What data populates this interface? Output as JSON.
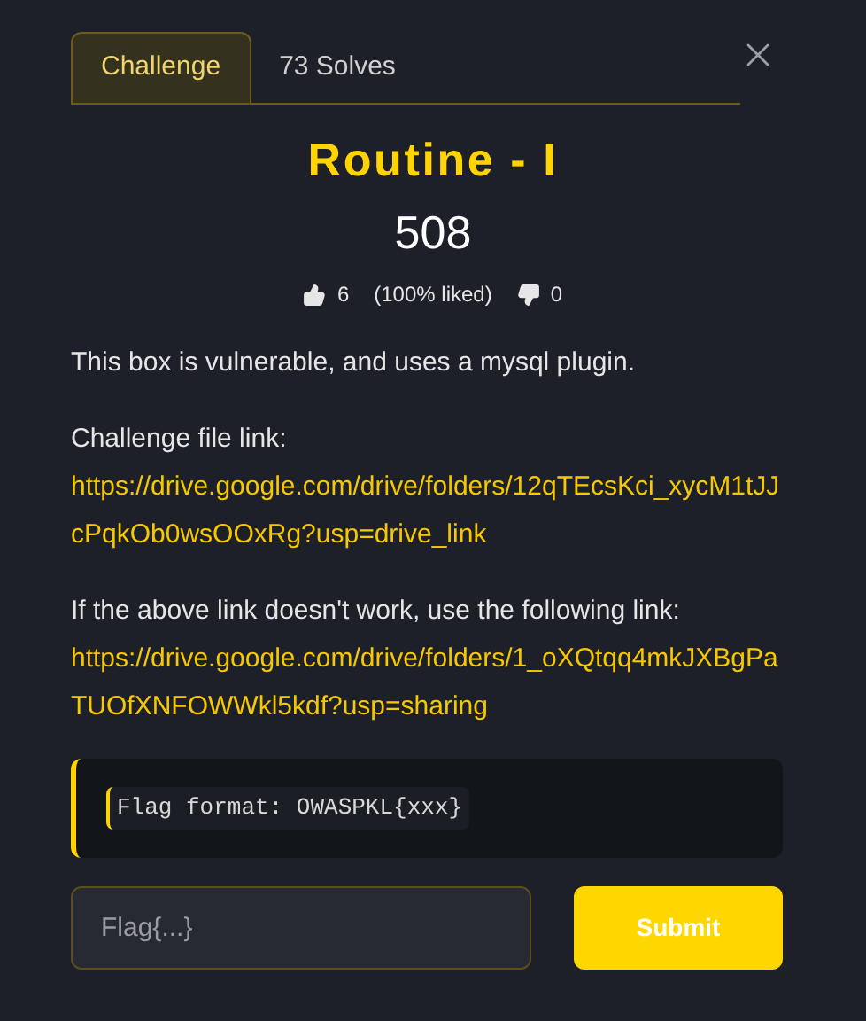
{
  "tabs": [
    {
      "label": "Challenge",
      "selected": true
    },
    {
      "label": "73 Solves",
      "selected": false
    }
  ],
  "title": "Routine - I",
  "points": "508",
  "likes": {
    "up": "6",
    "ratio": "(100% liked)",
    "down": "0"
  },
  "description": [
    {
      "kind": "text",
      "text": "This box is vulnerable, and uses a mysql plugin."
    },
    {
      "kind": "text",
      "text": "Challenge file link:"
    },
    {
      "kind": "link",
      "text": "https://drive.google.com/drive/folders/12qTEcsKci_xycM1tJJcPqkOb0wsOOxRg?usp=drive_link"
    },
    {
      "kind": "text",
      "text": "If the above link doesn't work, use the following link:"
    },
    {
      "kind": "link",
      "text": "https://drive.google.com/drive/folders/1_oXQtqq4mkJXBgPaTUOfXNFOWWkl5kdf?usp=sharing"
    }
  ],
  "note": "Flag format: OWASPKL{xxx}",
  "flag_field": {
    "placeholder": "Flag{...}"
  },
  "submit": "Submit"
}
